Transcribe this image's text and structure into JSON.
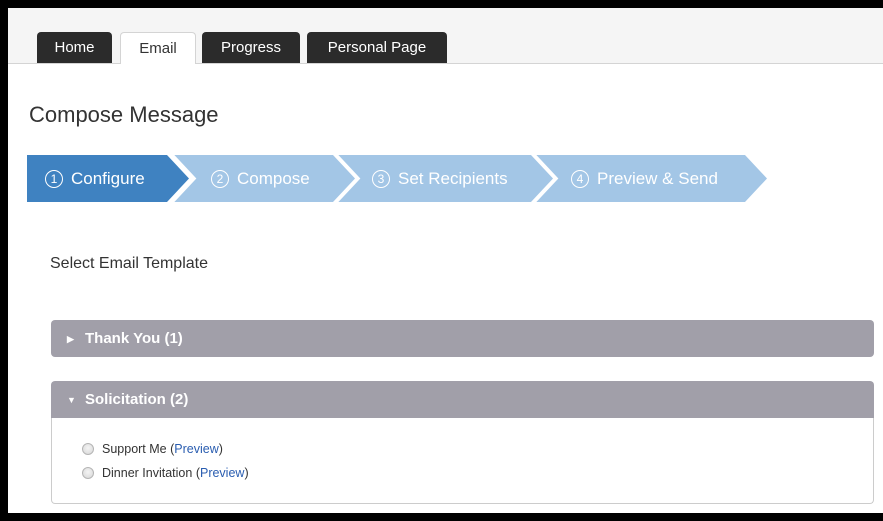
{
  "tabs": [
    {
      "label": "Home",
      "active": false
    },
    {
      "label": "Email",
      "active": true
    },
    {
      "label": "Progress",
      "active": false
    },
    {
      "label": "Personal Page",
      "active": false
    }
  ],
  "page_title": "Compose Message",
  "wizard": {
    "steps": [
      {
        "num": "1",
        "label": "Configure",
        "active": true
      },
      {
        "num": "2",
        "label": "Compose",
        "active": false
      },
      {
        "num": "3",
        "label": "Set Recipients",
        "active": false
      },
      {
        "num": "4",
        "label": "Preview & Send",
        "active": false
      }
    ]
  },
  "section_label": "Select Email Template",
  "accordion": [
    {
      "title": "Thank You (1)",
      "expanded": false,
      "caret": "▶"
    },
    {
      "title": "Solicitation (2)",
      "expanded": true,
      "caret": "▼",
      "options": [
        {
          "label": "Support Me",
          "link": "Preview",
          "open_paren": "(",
          "close_paren": ")"
        },
        {
          "label": "Dinner Invitation",
          "link": "Preview",
          "open_paren": "(",
          "close_paren": ")"
        }
      ]
    }
  ],
  "colors": {
    "step_active": "#3f82c1",
    "step_inactive": "#a3c6e6",
    "accordion_header": "#a19fa9",
    "link": "#2a5db0"
  }
}
